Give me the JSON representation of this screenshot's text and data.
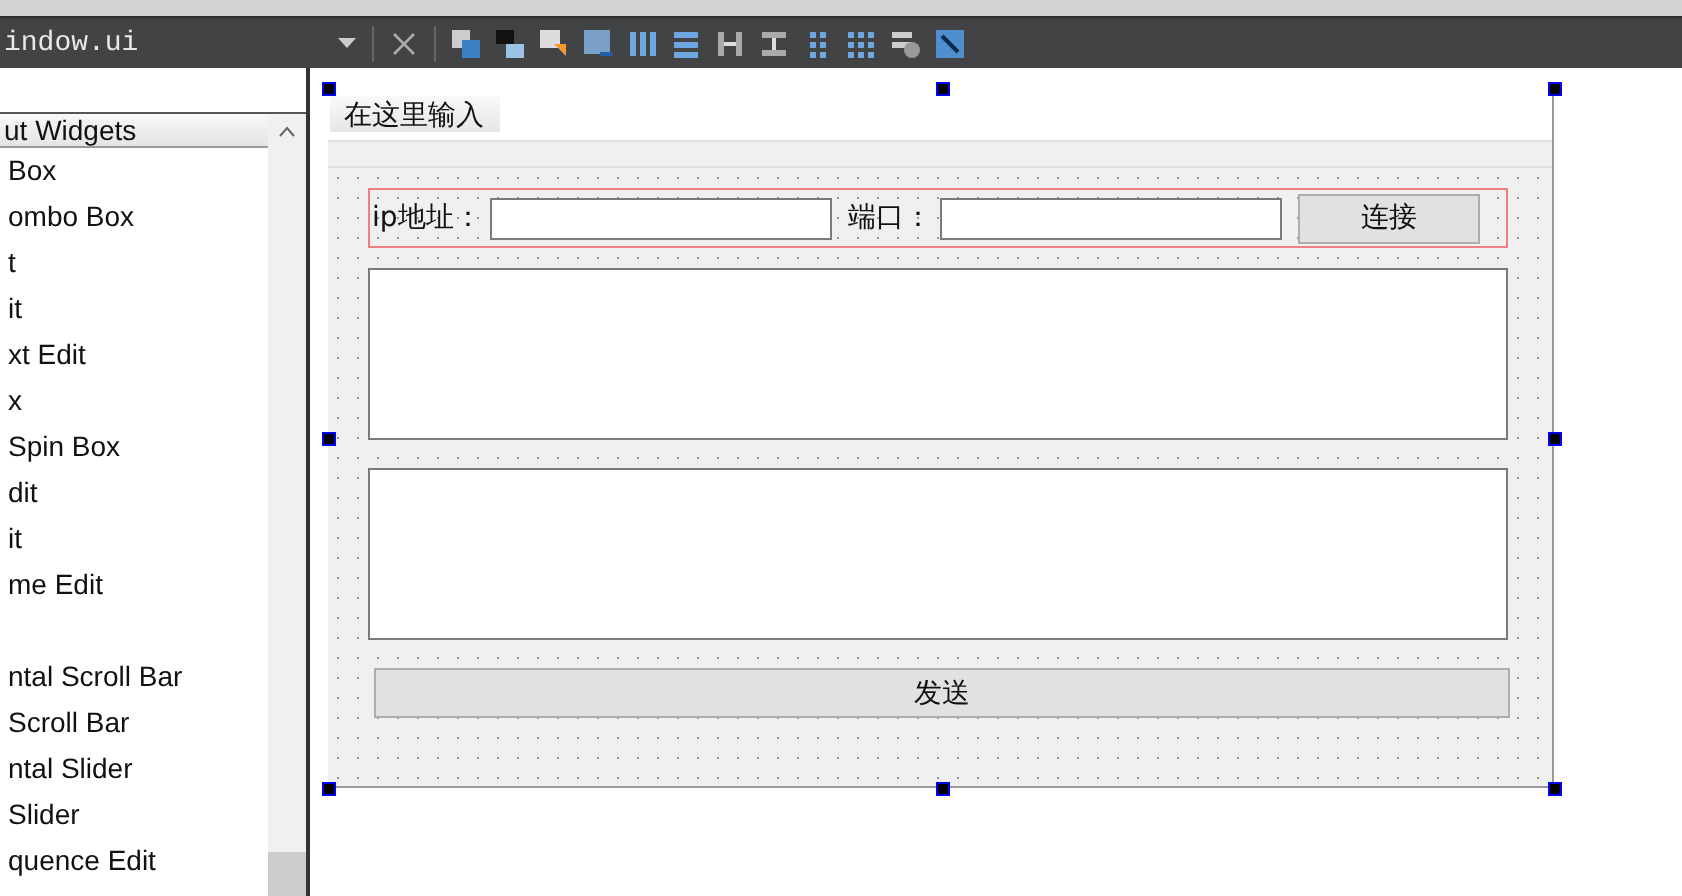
{
  "toolbar": {
    "file_selector": {
      "value": "indow.ui"
    }
  },
  "widget_box": {
    "header": "ut Widgets",
    "items": [
      "Box",
      "ombo Box",
      "t",
      "it",
      "xt Edit",
      "x",
      "Spin Box",
      "dit",
      "it",
      "me Edit"
    ],
    "items_after_gap": [
      "ntal Scroll Bar",
      "Scroll Bar",
      "ntal Slider",
      "Slider",
      "quence Edit"
    ]
  },
  "form": {
    "menu_item": "在这里输入",
    "ip_label": "ip地址：",
    "port_label": "端口：",
    "connect_button": "连接",
    "send_button": "发送"
  }
}
